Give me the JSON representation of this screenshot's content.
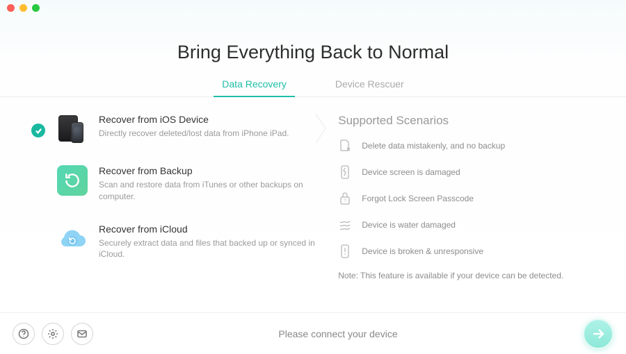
{
  "title": "Bring Everything Back to Normal",
  "tabs": [
    {
      "label": "Data Recovery",
      "active": true
    },
    {
      "label": "Device Rescuer",
      "active": false
    }
  ],
  "options": [
    {
      "title": "Recover from iOS Device",
      "desc": "Directly recover deleted/lost data from iPhone iPad.",
      "selected": true,
      "icon": "devices-icon"
    },
    {
      "title": "Recover from Backup",
      "desc": "Scan and restore data from iTunes or other backups on computer.",
      "selected": false,
      "icon": "backup-icon"
    },
    {
      "title": "Recover from iCloud",
      "desc": "Securely extract data and files that backed up or synced in iCloud.",
      "selected": false,
      "icon": "cloud-icon"
    }
  ],
  "scenarios_title": "Supported Scenarios",
  "scenarios": [
    {
      "label": "Delete data mistakenly, and no backup",
      "icon": "file-delete-icon"
    },
    {
      "label": "Device screen is damaged",
      "icon": "screen-broken-icon"
    },
    {
      "label": "Forgot Lock Screen Passcode",
      "icon": "lock-icon"
    },
    {
      "label": "Device is water damaged",
      "icon": "water-icon"
    },
    {
      "label": "Device is broken & unresponsive",
      "icon": "alert-icon"
    }
  ],
  "note": "Note: This feature is available if your device can be detected.",
  "footer_status": "Please connect your device",
  "footer_buttons": {
    "help": "help-icon",
    "settings": "gear-icon",
    "feedback": "mail-icon",
    "next": "arrow-right-icon"
  }
}
